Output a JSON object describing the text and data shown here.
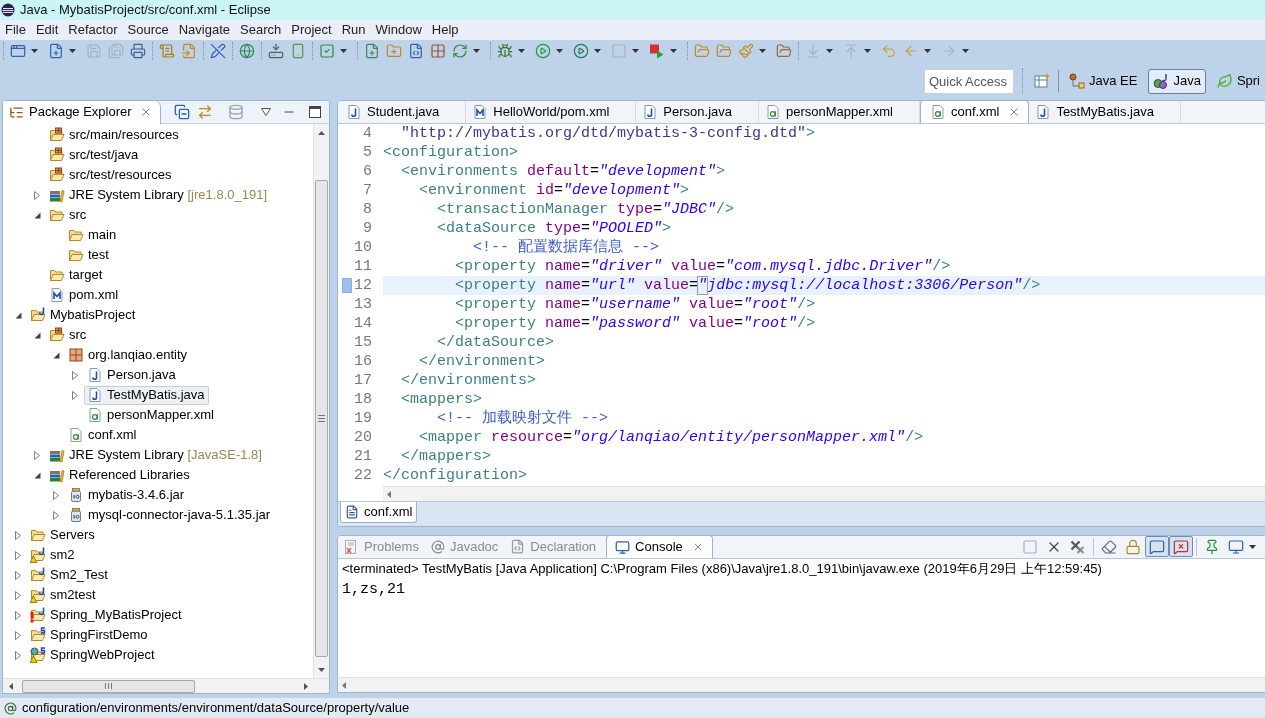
{
  "window": {
    "title": "Java - MybatisProject/src/conf.xml - Eclipse"
  },
  "menu": [
    "File",
    "Edit",
    "Refactor",
    "Source",
    "Navigate",
    "Search",
    "Project",
    "Run",
    "Window",
    "Help"
  ],
  "toolbar": {
    "groups": [
      [
        {
          "disabled": false,
          "menu": true
        },
        {
          "disabled": false,
          "menu": true
        },
        {
          "disabled": true,
          "menu": false
        },
        {
          "disabled": true,
          "menu": false
        },
        {
          "disabled": false,
          "menu": false
        }
      ],
      [
        {
          "disabled": false,
          "menu": false
        },
        {
          "disabled": false,
          "menu": false
        }
      ],
      [
        {
          "disabled": false,
          "menu": false
        }
      ],
      [
        {
          "disabled": false,
          "menu": false
        }
      ],
      [
        {
          "disabled": false,
          "menu": false
        },
        {
          "disabled": false,
          "menu": false
        }
      ],
      [
        {
          "disabled": false,
          "menu": true
        }
      ],
      [
        {
          "disabled": false,
          "menu": false
        },
        {
          "disabled": false,
          "menu": false
        },
        {
          "disabled": false,
          "menu": false
        },
        {
          "disabled": false,
          "menu": false
        },
        {
          "disabled": false,
          "menu": true
        }
      ],
      [
        {
          "disabled": false,
          "menu": true
        },
        {
          "disabled": false,
          "menu": true
        },
        {
          "disabled": false,
          "menu": true
        },
        {
          "disabled": true,
          "menu": true
        },
        {
          "disabled": false,
          "menu": true
        }
      ],
      [
        {
          "disabled": false,
          "menu": false
        },
        {
          "disabled": false,
          "menu": false
        },
        {
          "disabled": false,
          "menu": true
        },
        {
          "disabled": false,
          "menu": false
        }
      ],
      [
        {
          "disabled": true,
          "menu": true
        },
        {
          "disabled": true,
          "menu": true
        },
        {
          "disabled": false,
          "menu": false
        },
        {
          "disabled": false,
          "menu": true
        },
        {
          "disabled": true,
          "menu": true
        }
      ]
    ]
  },
  "quick_access": {
    "placeholder": "Quick Access"
  },
  "perspectives": [
    {
      "label": "Java EE",
      "selected": false
    },
    {
      "label": "Java",
      "selected": true
    },
    {
      "label": "Spri",
      "selected": false
    }
  ],
  "package_explorer": {
    "tab": {
      "label": "Package Explorer",
      "selected": true
    },
    "tree": [
      {
        "children": [
          {
            "label": "src/main/resources",
            "kind": "source-folder",
            "selected": false
          },
          {
            "label": "src/test/java",
            "kind": "source-folder",
            "selected": false
          },
          {
            "label": "src/test/resources",
            "kind": "source-folder",
            "selected": false
          },
          {
            "label": "JRE System Library",
            "decoration": "[jre1.8.0_191]",
            "kind": "library",
            "expanded": false,
            "selected": false
          },
          {
            "label": "src",
            "kind": "folder",
            "expanded": true,
            "selected": false,
            "children": [
              {
                "label": "main",
                "kind": "folder",
                "selected": false
              },
              {
                "label": "test",
                "kind": "folder",
                "selected": false
              }
            ]
          },
          {
            "label": "target",
            "kind": "folder",
            "selected": false
          },
          {
            "label": "pom.xml",
            "kind": "pom",
            "selected": false
          }
        ]
      },
      {
        "label": "MybatisProject",
        "kind": "project",
        "warning": false,
        "error": false,
        "expanded": true,
        "selected": false,
        "children": [
          {
            "label": "src",
            "kind": "source-folder",
            "expanded": true,
            "selected": false,
            "children": [
              {
                "label": "org.lanqiao.entity",
                "kind": "package",
                "expanded": true,
                "selected": false,
                "children": [
                  {
                    "label": "Person.java",
                    "kind": "java",
                    "expanded": false,
                    "selected": false
                  },
                  {
                    "label": "TestMyBatis.java",
                    "kind": "java",
                    "expanded": false,
                    "selected": true
                  },
                  {
                    "label": "personMapper.xml",
                    "kind": "xml",
                    "selected": false
                  }
                ]
              },
              {
                "label": "conf.xml",
                "kind": "xml",
                "selected": false
              }
            ]
          },
          {
            "label": "JRE System Library",
            "decoration": "[JavaSE-1.8]",
            "kind": "library",
            "expanded": false,
            "selected": false
          },
          {
            "label": "Referenced Libraries",
            "kind": "library",
            "expanded": true,
            "selected": false,
            "children": [
              {
                "label": "mybatis-3.4.6.jar",
                "kind": "jar",
                "expanded": false,
                "selected": false
              },
              {
                "label": "mysql-connector-java-5.1.35.jar",
                "kind": "jar",
                "expanded": false,
                "selected": false
              }
            ]
          }
        ]
      },
      {
        "label": "Servers",
        "kind": "folder",
        "warning": false,
        "error": false,
        "expanded": false,
        "selected": false
      },
      {
        "label": "sm2",
        "kind": "project",
        "warning": true,
        "error": false,
        "expanded": false,
        "selected": false
      },
      {
        "label": "Sm2_Test",
        "kind": "project",
        "warning": false,
        "error": false,
        "expanded": false,
        "selected": false
      },
      {
        "label": "sm2test",
        "kind": "project",
        "warning": true,
        "error": false,
        "expanded": false,
        "selected": false
      },
      {
        "label": "Spring_MyBatisProject",
        "kind": "project",
        "warning": false,
        "error": true,
        "expanded": false,
        "selected": false
      },
      {
        "label": "SpringFirstDemo",
        "kind": "spring-project",
        "warning": false,
        "error": false,
        "expanded": false,
        "selected": false
      },
      {
        "label": "SpringWebProject",
        "kind": "web-project",
        "warning": true,
        "error": false,
        "expanded": false,
        "selected": false
      }
    ]
  },
  "editor": {
    "tabs": [
      {
        "label": "Student.java",
        "kind": "java",
        "selected": false
      },
      {
        "label": "HelloWorld/pom.xml",
        "kind": "pom",
        "selected": false
      },
      {
        "label": "Person.java",
        "kind": "java",
        "selected": false
      },
      {
        "label": "personMapper.xml",
        "kind": "xml",
        "selected": false
      },
      {
        "label": "conf.xml",
        "kind": "xml",
        "selected": true
      },
      {
        "label": "TestMyBatis.java",
        "kind": "java",
        "selected": false
      }
    ],
    "lines": [
      {
        "number": "4",
        "current": false,
        "tokens": [
          {
            "kind": "string",
            "text": "  \"http://mybatis.org/dtd/mybatis-3-config.dtd\""
          },
          {
            "kind": "tag",
            "text": ">"
          }
        ]
      },
      {
        "number": "5",
        "current": false,
        "tokens": [
          {
            "kind": "tag",
            "text": "<configuration>"
          }
        ]
      },
      {
        "number": "6",
        "current": false,
        "tokens": [
          {
            "kind": "tag",
            "text": "  <environments"
          },
          {
            "kind": "attr",
            "text": " default"
          },
          {
            "kind": "plain",
            "text": "="
          },
          {
            "kind": "value",
            "text": "\"development\""
          },
          {
            "kind": "tag",
            "text": ">"
          }
        ]
      },
      {
        "number": "7",
        "current": false,
        "tokens": [
          {
            "kind": "tag",
            "text": "    <environment"
          },
          {
            "kind": "attr",
            "text": " id"
          },
          {
            "kind": "plain",
            "text": "="
          },
          {
            "kind": "value",
            "text": "\"development\""
          },
          {
            "kind": "tag",
            "text": ">"
          }
        ]
      },
      {
        "number": "8",
        "current": false,
        "tokens": [
          {
            "kind": "tag",
            "text": "      <transactionManager"
          },
          {
            "kind": "attr",
            "text": " type"
          },
          {
            "kind": "plain",
            "text": "="
          },
          {
            "kind": "value",
            "text": "\"JDBC\""
          },
          {
            "kind": "tag",
            "text": "/>"
          }
        ]
      },
      {
        "number": "9",
        "current": false,
        "tokens": [
          {
            "kind": "tag",
            "text": "      <dataSource"
          },
          {
            "kind": "attr",
            "text": " type"
          },
          {
            "kind": "plain",
            "text": "="
          },
          {
            "kind": "value",
            "text": "\"POOLED\""
          },
          {
            "kind": "tag",
            "text": ">"
          }
        ]
      },
      {
        "number": "10",
        "current": false,
        "tokens": [
          {
            "kind": "comment",
            "text": "          <!-- 配置数据库信息 -->"
          }
        ]
      },
      {
        "number": "11",
        "current": false,
        "tokens": [
          {
            "kind": "tag",
            "text": "        <property"
          },
          {
            "kind": "attr",
            "text": " name"
          },
          {
            "kind": "plain",
            "text": "="
          },
          {
            "kind": "value",
            "text": "\"driver\""
          },
          {
            "kind": "attr",
            "text": " value"
          },
          {
            "kind": "plain",
            "text": "="
          },
          {
            "kind": "value",
            "text": "\"com.mysql.jdbc.Driver\""
          },
          {
            "kind": "tag",
            "text": "/>"
          }
        ]
      },
      {
        "number": "12",
        "current": true,
        "tokens": [
          {
            "kind": "tag",
            "text": "        <property"
          },
          {
            "kind": "attr",
            "text": " name"
          },
          {
            "kind": "plain",
            "text": "="
          },
          {
            "kind": "value",
            "text": "\"url\""
          },
          {
            "kind": "attr",
            "text": " value"
          },
          {
            "kind": "plain",
            "text": "="
          },
          {
            "kind": "matched",
            "text": "\""
          },
          {
            "kind": "value",
            "text": "jdbc:mysql://localhost:3306/Person\""
          },
          {
            "kind": "tag",
            "text": "/>"
          }
        ]
      },
      {
        "number": "13",
        "current": false,
        "tokens": [
          {
            "kind": "tag",
            "text": "        <property"
          },
          {
            "kind": "attr",
            "text": " name"
          },
          {
            "kind": "plain",
            "text": "="
          },
          {
            "kind": "value",
            "text": "\"username\""
          },
          {
            "kind": "attr",
            "text": " value"
          },
          {
            "kind": "plain",
            "text": "="
          },
          {
            "kind": "value",
            "text": "\"root\""
          },
          {
            "kind": "tag",
            "text": "/>"
          }
        ]
      },
      {
        "number": "14",
        "current": false,
        "tokens": [
          {
            "kind": "tag",
            "text": "        <property"
          },
          {
            "kind": "attr",
            "text": " name"
          },
          {
            "kind": "plain",
            "text": "="
          },
          {
            "kind": "value",
            "text": "\"password\""
          },
          {
            "kind": "attr",
            "text": " value"
          },
          {
            "kind": "plain",
            "text": "="
          },
          {
            "kind": "value",
            "text": "\"root\""
          },
          {
            "kind": "tag",
            "text": "/>"
          }
        ]
      },
      {
        "number": "15",
        "current": false,
        "tokens": [
          {
            "kind": "tag",
            "text": "      </dataSource>"
          }
        ]
      },
      {
        "number": "16",
        "current": false,
        "tokens": [
          {
            "kind": "tag",
            "text": "    </environment>"
          }
        ]
      },
      {
        "number": "17",
        "current": false,
        "tokens": [
          {
            "kind": "tag",
            "text": "  </environments>"
          }
        ]
      },
      {
        "number": "18",
        "current": false,
        "tokens": [
          {
            "kind": "tag",
            "text": "  <mappers>"
          }
        ]
      },
      {
        "number": "19",
        "current": false,
        "tokens": [
          {
            "kind": "comment",
            "text": "      <!-- 加载映射文件 -->"
          }
        ]
      },
      {
        "number": "20",
        "current": false,
        "tokens": [
          {
            "kind": "tag",
            "text": "    <mapper"
          },
          {
            "kind": "attr",
            "text": " resource"
          },
          {
            "kind": "plain",
            "text": "="
          },
          {
            "kind": "value",
            "text": "\"org/lanqiao/entity/personMapper.xml\""
          },
          {
            "kind": "tag",
            "text": "/>"
          }
        ]
      },
      {
        "number": "21",
        "current": false,
        "tokens": [
          {
            "kind": "tag",
            "text": "  </mappers>"
          }
        ]
      },
      {
        "number": "22",
        "current": false,
        "tokens": [
          {
            "kind": "tag",
            "text": "</configuration>"
          }
        ]
      }
    ],
    "page_tabs": [
      {
        "label": "conf.xml",
        "selected": true
      }
    ]
  },
  "console": {
    "tabs": [
      {
        "label": "Problems",
        "kind": "problems",
        "selected": false
      },
      {
        "label": "Javadoc",
        "kind": "javadoc",
        "selected": false
      },
      {
        "label": "Declaration",
        "kind": "declaration",
        "selected": false
      },
      {
        "label": "Console",
        "kind": "console",
        "selected": true
      }
    ],
    "toolbar": {
      "groups": [
        [
          {
            "disabled": true,
            "pressed": false,
            "menu": false
          },
          {
            "disabled": false,
            "pressed": false,
            "menu": false
          },
          {
            "disabled": false,
            "pressed": false,
            "menu": false
          }
        ],
        [
          {
            "disabled": false,
            "pressed": false,
            "menu": false
          },
          {
            "disabled": false,
            "pressed": false,
            "menu": false
          },
          {
            "disabled": false,
            "pressed": true,
            "menu": false
          },
          {
            "disabled": false,
            "pressed": true,
            "menu": false
          }
        ],
        [
          {
            "disabled": false,
            "pressed": false,
            "menu": false
          },
          {
            "disabled": false,
            "pressed": false,
            "menu": true
          }
        ]
      ]
    },
    "lines": [
      {
        "kind": "info",
        "text": "<terminated> TestMyBatis [Java Application] C:\\Program Files (x86)\\Java\\jre1.8.0_191\\bin\\javaw.exe (2019年6月29日 上午12:59:45)"
      },
      {
        "kind": "output",
        "text": "1,zs,21"
      }
    ]
  },
  "status_bar": {
    "text": "configuration/environments/environment/dataSource/property/value"
  }
}
